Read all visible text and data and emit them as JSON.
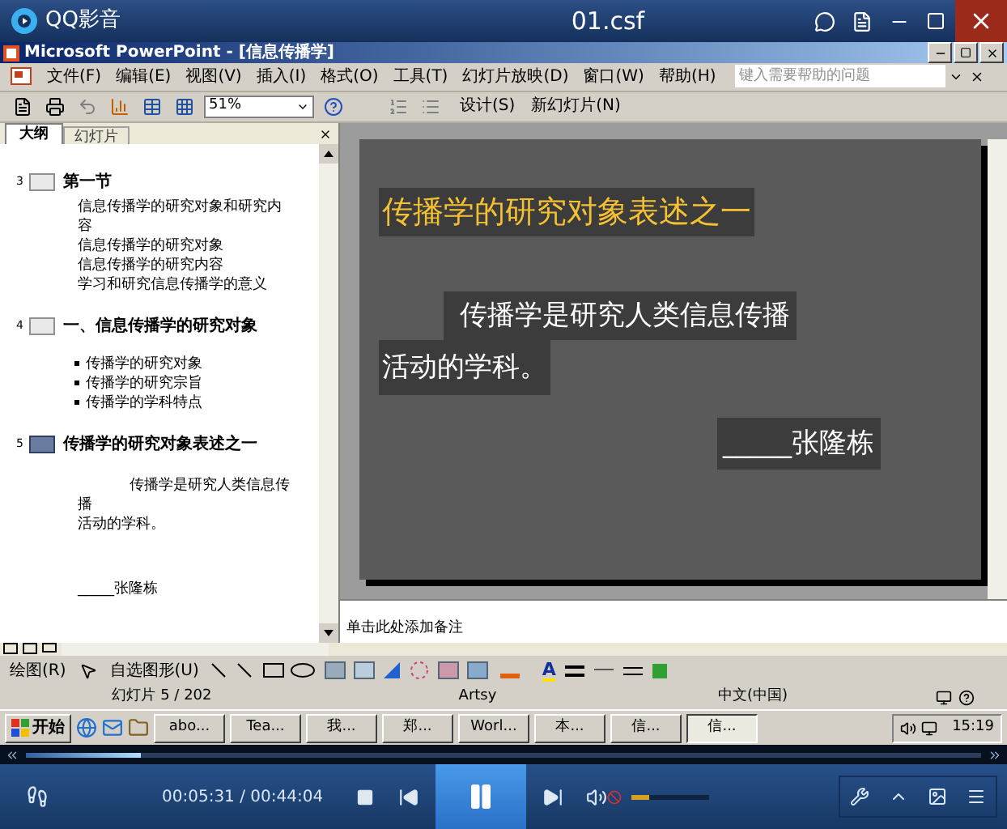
{
  "player": {
    "title": "QQ影音",
    "file": "01.csf"
  },
  "ppt": {
    "title": "Microsoft PowerPoint - [信息传播学]",
    "menu": [
      "文件(F)",
      "编辑(E)",
      "视图(V)",
      "插入(I)",
      "格式(O)",
      "工具(T)",
      "幻灯片放映(D)",
      "窗口(W)",
      "帮助(H)"
    ],
    "help_placeholder": "键入需要帮助的问题",
    "zoom": "51%",
    "toolbar_buttons": [
      "设计(S)",
      "新幻灯片(N)"
    ]
  },
  "outline": {
    "tabs": [
      {
        "label": "大纲",
        "selected": true
      },
      {
        "label": "幻灯片",
        "selected": false
      }
    ],
    "slides": [
      {
        "number": "3",
        "selected": false,
        "title": "第一节",
        "kind": "text",
        "lines": [
          "信息传播学的研究对象和研究内容",
          "信息传播学的研究对象",
          "信息传播学的研究内容",
          "学习和研究信息传播学的意义"
        ]
      },
      {
        "number": "4",
        "selected": false,
        "title": "一、信息传播学的研究对象",
        "kind": "bullets",
        "lines": [
          "传播学的研究对象",
          "传播学的研究宗旨",
          "传播学的学科特点"
        ]
      },
      {
        "number": "5",
        "selected": true,
        "title": "传播学的研究对象表述之一",
        "kind": "body",
        "lines": [
          "传播学是研究人类信息传播",
          "活动的学科。",
          "_____张隆栋"
        ]
      }
    ]
  },
  "slide": {
    "title": "传播学的研究对象表述之一",
    "body": [
      "传播学是研究人类信息传播",
      "活动的学科。"
    ],
    "author": "_____张隆栋"
  },
  "notes_placeholder": "单击此处添加备注",
  "drawing": {
    "draw": "绘图(R)",
    "autoshapes": "自选图形(U)",
    "font_color": "A"
  },
  "status": [
    "幻灯片 5 / 202",
    "Artsy",
    "中文(中国)"
  ],
  "taskbar": {
    "start": "开始",
    "tasks": [
      {
        "label": "abo...",
        "selected": false
      },
      {
        "label": "Tea...",
        "selected": false
      },
      {
        "label": "我...",
        "selected": false
      },
      {
        "label": "郑...",
        "selected": false
      },
      {
        "label": "Worl...",
        "selected": false
      },
      {
        "label": "本...",
        "selected": false
      },
      {
        "label": "信...",
        "selected": false
      },
      {
        "label": "信...",
        "selected": true
      }
    ],
    "clock": "15:19"
  },
  "controls": {
    "time": "00:05:31 / 00:44:04",
    "progress": {
      "level": 0.12
    },
    "playing": true,
    "muted": true,
    "volume": {
      "level": 0.22
    }
  }
}
